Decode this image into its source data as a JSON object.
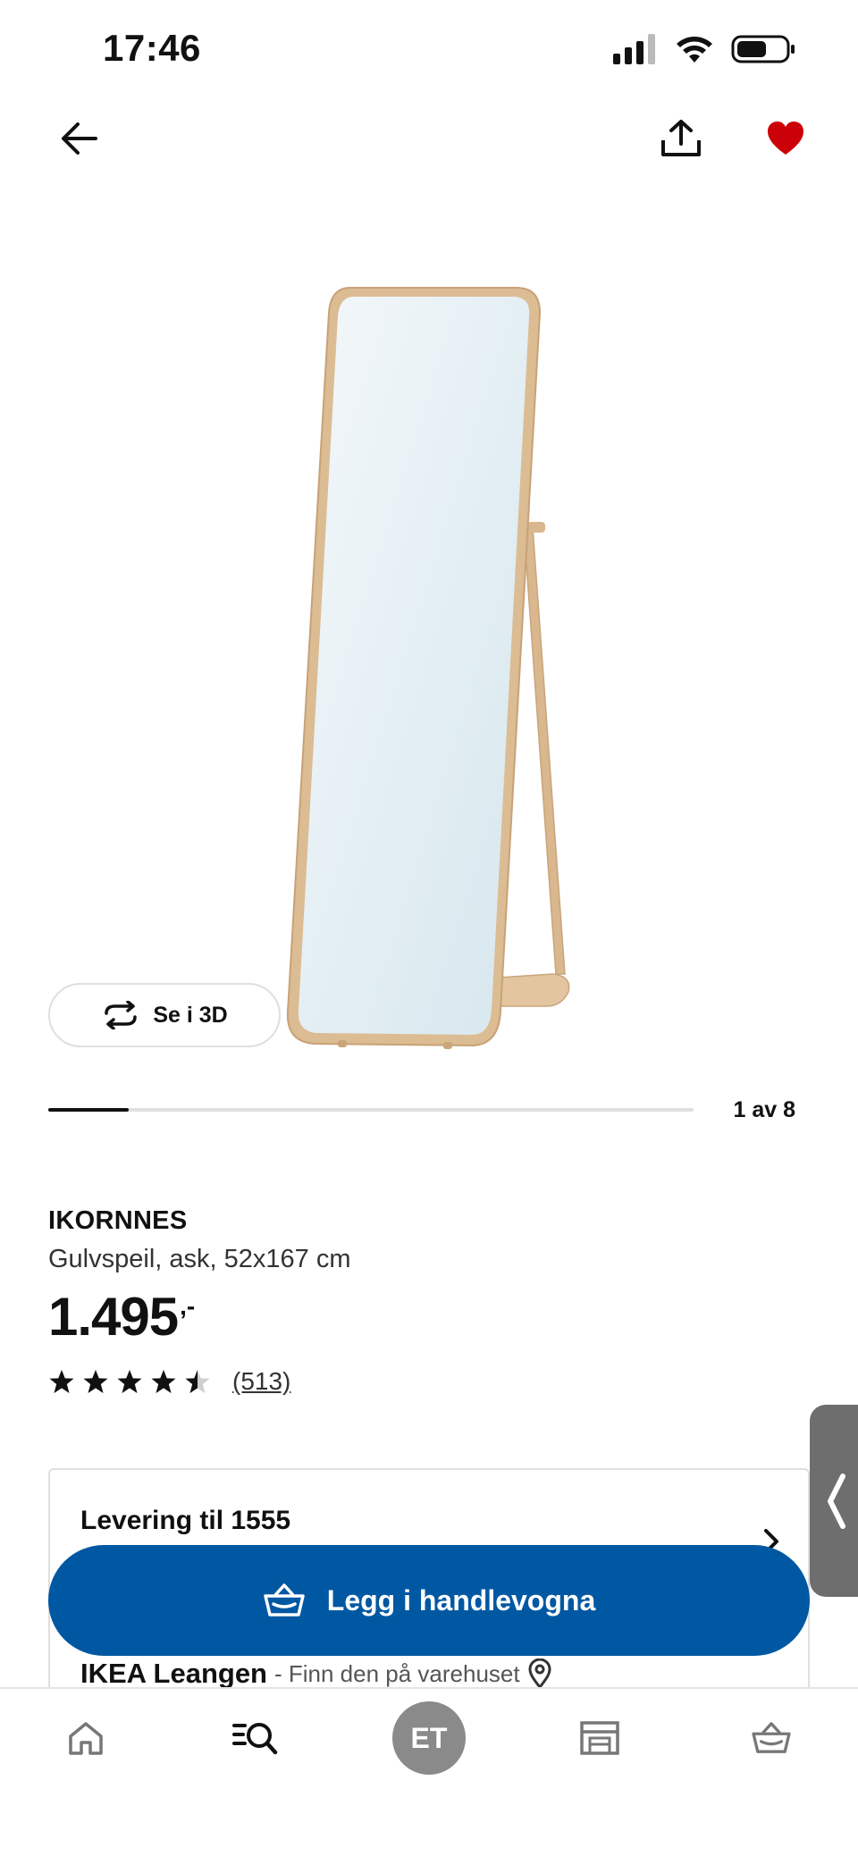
{
  "status_bar": {
    "time": "17:46",
    "icons": [
      "cellular-signal-icon",
      "wifi-icon",
      "battery-icon"
    ]
  },
  "top_nav": {
    "back_icon": "arrow-left-icon",
    "share_icon": "share-icon",
    "favorite_icon": "heart-icon",
    "favorite_active": true
  },
  "gallery": {
    "btn_3d_label": "Se i 3D",
    "btn_3d_icon": "rotate-3d-icon",
    "current": 1,
    "total": 8,
    "position_label": "1 av 8",
    "progress_fraction": 0.125
  },
  "product": {
    "name": "IKORNNES",
    "description": "Gulvspeil, ask, 52x167 cm",
    "price": "1.495",
    "price_suffix": ",-",
    "rating": 4.5,
    "rating_max": 5,
    "review_count": "(513)"
  },
  "delivery": {
    "title": "Levering til 1555",
    "chevron_icon": "chevron-right-icon",
    "store_name": "IKEA Leangen",
    "store_note": " - Finn den på varehuset",
    "location_icon": "location-pin-icon"
  },
  "cart_button": {
    "label": "Legg i handlevogna",
    "icon": "shopping-basket-icon"
  },
  "side_tab": {
    "icon": "chevron-left-icon"
  },
  "bottom_nav": {
    "items": [
      {
        "name": "home",
        "icon": "home-icon"
      },
      {
        "name": "search",
        "icon": "search-list-icon"
      },
      {
        "name": "profile",
        "label": "ET"
      },
      {
        "name": "store",
        "icon": "store-icon"
      },
      {
        "name": "cart",
        "icon": "basket-icon"
      }
    ]
  },
  "colors": {
    "brand_blue": "#0058a3",
    "heart_red": "#cc0008",
    "wood": "#d9b88f"
  }
}
